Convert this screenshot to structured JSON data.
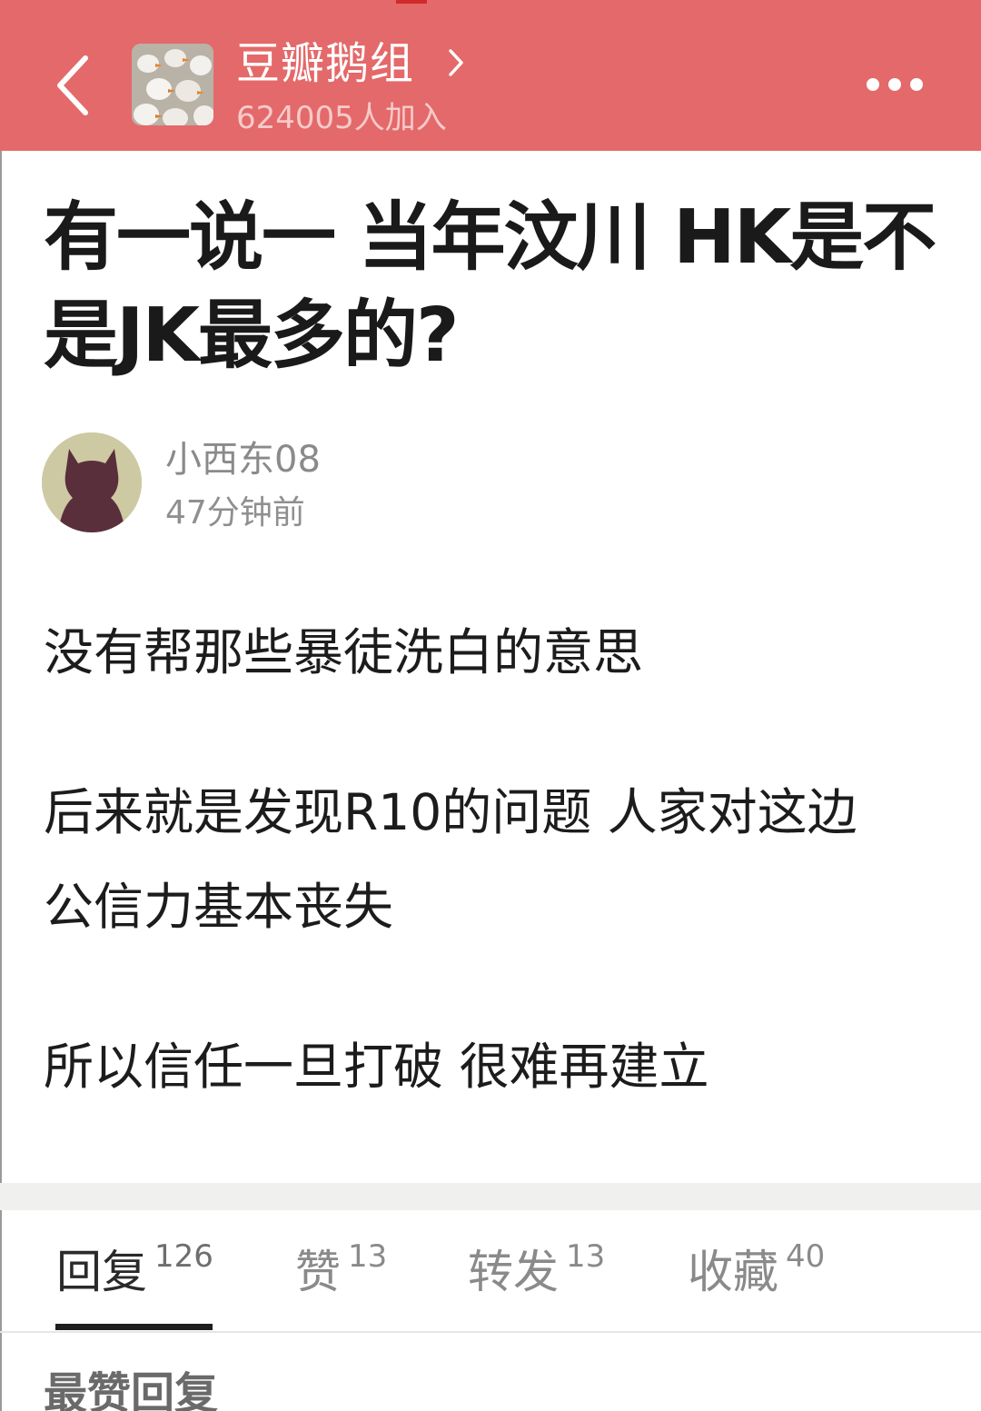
{
  "header": {
    "group_name": "豆瓣鹅组",
    "member_count": "624005人加入",
    "back_icon": "chevron-left-icon",
    "more_icon": "more-horizontal-icon",
    "background_color": "#e4696a"
  },
  "post": {
    "title": "有一说一 当年汶川 HK是不是JK最多的?",
    "author": "小西东08",
    "time": "47分钟前",
    "paragraphs": [
      "没有帮那些暴徒洗白的意思",
      "后来就是发现R10的问题 人家对这边",
      "公信力基本丧失",
      "所以信任一旦打破 很难再建立"
    ]
  },
  "tabs": [
    {
      "label": "回复",
      "count": "126",
      "active": true
    },
    {
      "label": "赞",
      "count": "13",
      "active": false
    },
    {
      "label": "转发",
      "count": "13",
      "active": false
    },
    {
      "label": "收藏",
      "count": "40",
      "active": false
    }
  ],
  "replies": {
    "heading": "最赞回复"
  }
}
